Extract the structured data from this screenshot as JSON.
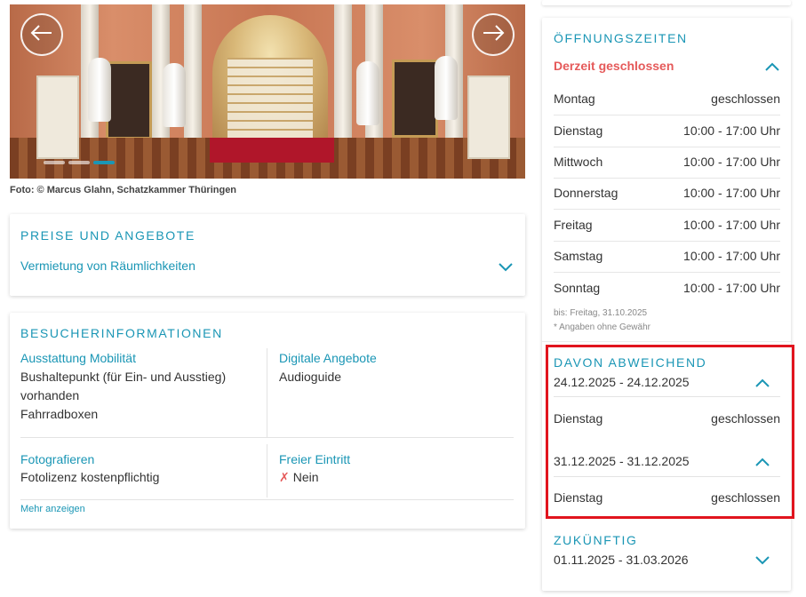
{
  "gallery": {
    "photo_credit": "Foto: © Marcus Glahn, Schatzkammer Thüringen",
    "prev_icon": "arrow-left-icon",
    "next_icon": "arrow-right-icon"
  },
  "prices": {
    "title": "PREISE UND ANGEBOTE",
    "item": "Vermietung von Räumlichkeiten"
  },
  "visitor_info": {
    "title": "BESUCHERINFORMATIONEN",
    "mobility_label": "Ausstattung Mobilität",
    "mobility_line1": "Bushaltepunkt (für Ein- und Ausstieg)",
    "mobility_line2": "vorhanden",
    "mobility_line3": "Fahrradboxen",
    "digital_label": "Digitale Angebote",
    "digital_value": "Audioguide",
    "photo_label": "Fotografieren",
    "photo_value": "Fotolizenz kostenpflichtig",
    "free_label": "Freier Eintritt",
    "free_mark": "✗",
    "free_value": "Nein",
    "more_link": "Mehr anzeigen"
  },
  "opening_hours": {
    "title": "ÖFFNUNGSZEITEN",
    "status": "Derzeit geschlossen",
    "status_color": "#e55a5a",
    "days": [
      {
        "day": "Montag",
        "time": "geschlossen"
      },
      {
        "day": "Dienstag",
        "time": "10:00 - 17:00 Uhr"
      },
      {
        "day": "Mittwoch",
        "time": "10:00 - 17:00 Uhr"
      },
      {
        "day": "Donnerstag",
        "time": "10:00 - 17:00 Uhr"
      },
      {
        "day": "Freitag",
        "time": "10:00 - 17:00 Uhr"
      },
      {
        "day": "Samstag",
        "time": "10:00 - 17:00 Uhr"
      },
      {
        "day": "Sonntag",
        "time": "10:00 - 17:00 Uhr"
      }
    ],
    "valid_until": "bis: Freitag, 31.10.2025",
    "disclaimer": "* Angaben ohne Gewähr",
    "deviating": {
      "title": "DAVON ABWEICHEND",
      "periods": [
        {
          "range": "24.12.2025 - 24.12.2025",
          "day": "Dienstag",
          "time": "geschlossen"
        },
        {
          "range": "31.12.2025 - 31.12.2025",
          "day": "Dienstag",
          "time": "geschlossen"
        }
      ]
    },
    "future": {
      "title": "ZUKÜNFTIG",
      "range": "01.11.2025 - 31.03.2026"
    }
  },
  "colors": {
    "accent": "#1a96b5",
    "highlight_border": "#e1141e"
  }
}
